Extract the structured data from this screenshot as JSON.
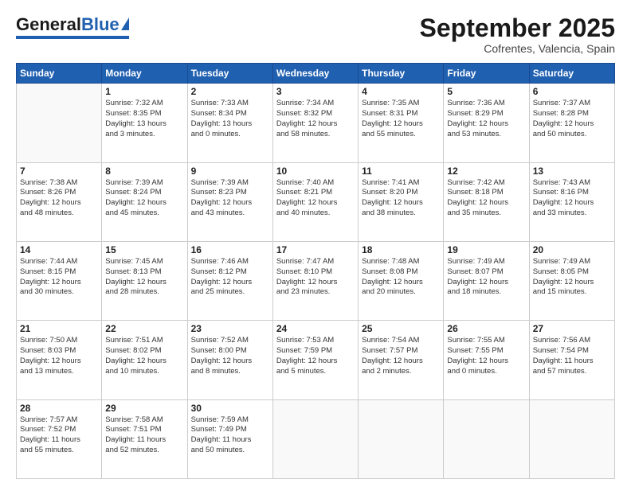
{
  "header": {
    "logo_general": "General",
    "logo_blue": "Blue",
    "title": "September 2025",
    "subtitle": "Cofrentes, Valencia, Spain"
  },
  "weekdays": [
    "Sunday",
    "Monday",
    "Tuesday",
    "Wednesday",
    "Thursday",
    "Friday",
    "Saturday"
  ],
  "weeks": [
    [
      {
        "date": "",
        "info": ""
      },
      {
        "date": "1",
        "info": "Sunrise: 7:32 AM\nSunset: 8:35 PM\nDaylight: 13 hours\nand 3 minutes."
      },
      {
        "date": "2",
        "info": "Sunrise: 7:33 AM\nSunset: 8:34 PM\nDaylight: 13 hours\nand 0 minutes."
      },
      {
        "date": "3",
        "info": "Sunrise: 7:34 AM\nSunset: 8:32 PM\nDaylight: 12 hours\nand 58 minutes."
      },
      {
        "date": "4",
        "info": "Sunrise: 7:35 AM\nSunset: 8:31 PM\nDaylight: 12 hours\nand 55 minutes."
      },
      {
        "date": "5",
        "info": "Sunrise: 7:36 AM\nSunset: 8:29 PM\nDaylight: 12 hours\nand 53 minutes."
      },
      {
        "date": "6",
        "info": "Sunrise: 7:37 AM\nSunset: 8:28 PM\nDaylight: 12 hours\nand 50 minutes."
      }
    ],
    [
      {
        "date": "7",
        "info": "Sunrise: 7:38 AM\nSunset: 8:26 PM\nDaylight: 12 hours\nand 48 minutes."
      },
      {
        "date": "8",
        "info": "Sunrise: 7:39 AM\nSunset: 8:24 PM\nDaylight: 12 hours\nand 45 minutes."
      },
      {
        "date": "9",
        "info": "Sunrise: 7:39 AM\nSunset: 8:23 PM\nDaylight: 12 hours\nand 43 minutes."
      },
      {
        "date": "10",
        "info": "Sunrise: 7:40 AM\nSunset: 8:21 PM\nDaylight: 12 hours\nand 40 minutes."
      },
      {
        "date": "11",
        "info": "Sunrise: 7:41 AM\nSunset: 8:20 PM\nDaylight: 12 hours\nand 38 minutes."
      },
      {
        "date": "12",
        "info": "Sunrise: 7:42 AM\nSunset: 8:18 PM\nDaylight: 12 hours\nand 35 minutes."
      },
      {
        "date": "13",
        "info": "Sunrise: 7:43 AM\nSunset: 8:16 PM\nDaylight: 12 hours\nand 33 minutes."
      }
    ],
    [
      {
        "date": "14",
        "info": "Sunrise: 7:44 AM\nSunset: 8:15 PM\nDaylight: 12 hours\nand 30 minutes."
      },
      {
        "date": "15",
        "info": "Sunrise: 7:45 AM\nSunset: 8:13 PM\nDaylight: 12 hours\nand 28 minutes."
      },
      {
        "date": "16",
        "info": "Sunrise: 7:46 AM\nSunset: 8:12 PM\nDaylight: 12 hours\nand 25 minutes."
      },
      {
        "date": "17",
        "info": "Sunrise: 7:47 AM\nSunset: 8:10 PM\nDaylight: 12 hours\nand 23 minutes."
      },
      {
        "date": "18",
        "info": "Sunrise: 7:48 AM\nSunset: 8:08 PM\nDaylight: 12 hours\nand 20 minutes."
      },
      {
        "date": "19",
        "info": "Sunrise: 7:49 AM\nSunset: 8:07 PM\nDaylight: 12 hours\nand 18 minutes."
      },
      {
        "date": "20",
        "info": "Sunrise: 7:49 AM\nSunset: 8:05 PM\nDaylight: 12 hours\nand 15 minutes."
      }
    ],
    [
      {
        "date": "21",
        "info": "Sunrise: 7:50 AM\nSunset: 8:03 PM\nDaylight: 12 hours\nand 13 minutes."
      },
      {
        "date": "22",
        "info": "Sunrise: 7:51 AM\nSunset: 8:02 PM\nDaylight: 12 hours\nand 10 minutes."
      },
      {
        "date": "23",
        "info": "Sunrise: 7:52 AM\nSunset: 8:00 PM\nDaylight: 12 hours\nand 8 minutes."
      },
      {
        "date": "24",
        "info": "Sunrise: 7:53 AM\nSunset: 7:59 PM\nDaylight: 12 hours\nand 5 minutes."
      },
      {
        "date": "25",
        "info": "Sunrise: 7:54 AM\nSunset: 7:57 PM\nDaylight: 12 hours\nand 2 minutes."
      },
      {
        "date": "26",
        "info": "Sunrise: 7:55 AM\nSunset: 7:55 PM\nDaylight: 12 hours\nand 0 minutes."
      },
      {
        "date": "27",
        "info": "Sunrise: 7:56 AM\nSunset: 7:54 PM\nDaylight: 11 hours\nand 57 minutes."
      }
    ],
    [
      {
        "date": "28",
        "info": "Sunrise: 7:57 AM\nSunset: 7:52 PM\nDaylight: 11 hours\nand 55 minutes."
      },
      {
        "date": "29",
        "info": "Sunrise: 7:58 AM\nSunset: 7:51 PM\nDaylight: 11 hours\nand 52 minutes."
      },
      {
        "date": "30",
        "info": "Sunrise: 7:59 AM\nSunset: 7:49 PM\nDaylight: 11 hours\nand 50 minutes."
      },
      {
        "date": "",
        "info": ""
      },
      {
        "date": "",
        "info": ""
      },
      {
        "date": "",
        "info": ""
      },
      {
        "date": "",
        "info": ""
      }
    ]
  ]
}
